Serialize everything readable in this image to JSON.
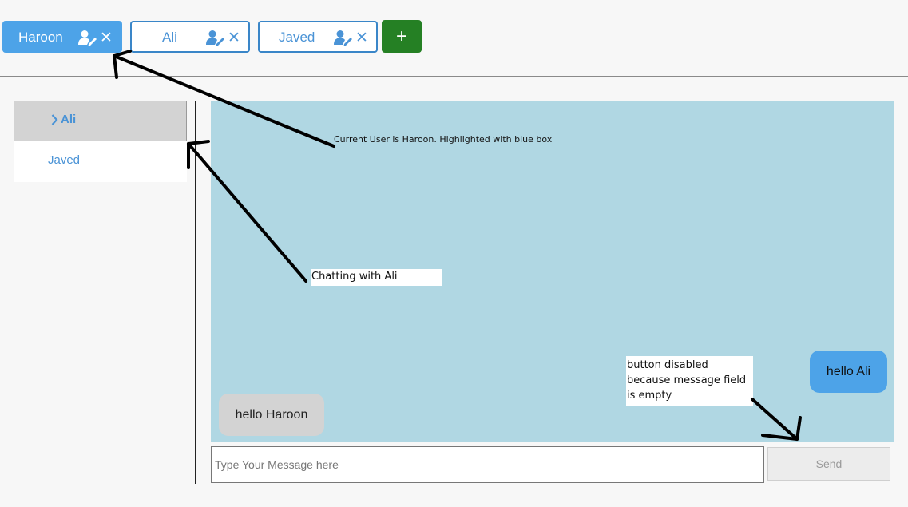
{
  "user_tabs": [
    {
      "label": "Haroon",
      "active": true,
      "edit_icon": "user-edit-icon",
      "close_icon": "close-icon"
    },
    {
      "label": "Ali",
      "active": false,
      "edit_icon": "user-edit-icon",
      "close_icon": "close-icon"
    },
    {
      "label": "Javed",
      "active": false,
      "edit_icon": "user-edit-icon",
      "close_icon": "close-icon"
    }
  ],
  "close_glyph": "✕",
  "add_user": {
    "label": "+"
  },
  "contacts": {
    "items": [
      {
        "label": "Ali",
        "selected": true,
        "icon": "chevron-right-icon"
      },
      {
        "label": "Javed",
        "selected": false
      }
    ]
  },
  "chat": {
    "messages": [
      {
        "text": "hello Haroon",
        "direction": "incoming"
      },
      {
        "text": "hello Ali",
        "direction": "outgoing"
      }
    ],
    "input_value": "",
    "input_placeholder": "Type Your Message here",
    "send_label": "Send",
    "send_disabled": true
  },
  "annotations": {
    "current_user": "Current User is Haroon. Highlighted with blue box",
    "chatting": "Chatting with Ali",
    "button_disabled": [
      "button disabled",
      "because message field",
      "is empty"
    ]
  },
  "colors": {
    "accent": "#4da3e8",
    "tab_border": "#3a86c8",
    "add_button": "#258024",
    "chat_background": "#b0d7e3",
    "selected_contact": "#d3d3d3"
  }
}
